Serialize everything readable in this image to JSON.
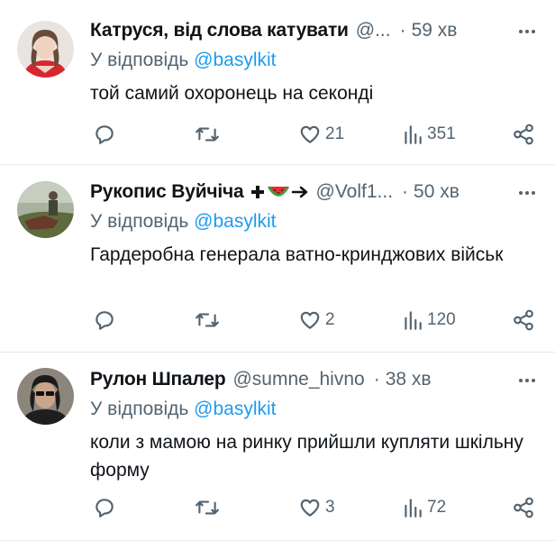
{
  "tweets": [
    {
      "name": "Катруся, від слова катувати",
      "handle": "@...",
      "time": "59 хв",
      "reply_prefix": "У відповідь",
      "reply_to": "@basylkit",
      "text": "той самий охоронець на секонді",
      "likes": "21",
      "views": "351"
    },
    {
      "name": "Рукопис Вуйчіча",
      "name_emoji": [
        "plus-icon",
        "watermelon-icon",
        "arrow-icon"
      ],
      "handle": "@Volf1...",
      "time": "50 хв",
      "reply_prefix": "У відповідь",
      "reply_to": "@basylkit",
      "text": "Гардеробна генерала ватно-кринджових військ",
      "likes": "2",
      "views": "120"
    },
    {
      "name": "Рулон Шпалер",
      "handle": "@sumne_hivno",
      "time": "38 хв",
      "reply_prefix": "У відповідь",
      "reply_to": "@basylkit",
      "text": "коли з мамою на ринку прийшли купляти шкільну форму",
      "likes": "3",
      "views": "72"
    }
  ],
  "separator": "·",
  "colors": {
    "text": "#0f1419",
    "secondary": "#536471",
    "link": "#1d9bf0"
  }
}
